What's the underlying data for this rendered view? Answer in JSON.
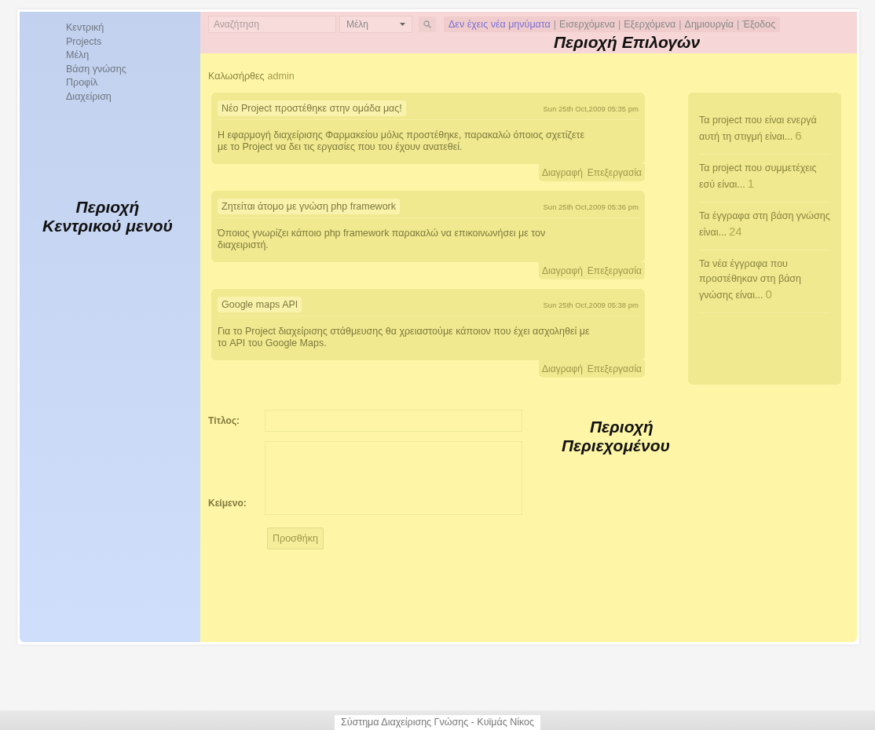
{
  "header": {
    "search": {
      "placeholder": "Αναζήτηση"
    },
    "select": {
      "value": "Μέλη"
    },
    "separator": "|",
    "links": [
      {
        "label": "Δεν έχεις νέα μηνύματα",
        "kind": "status"
      },
      {
        "label": "Εισερχόμενα",
        "kind": "link"
      },
      {
        "label": "Εξερχόμενα",
        "kind": "link"
      },
      {
        "label": "Δημιουργία",
        "kind": "link"
      },
      {
        "label": "Έξοδος",
        "kind": "link"
      }
    ],
    "annotation": {
      "lines": [
        "Περιοχή Επιλογών"
      ]
    }
  },
  "sidebar": {
    "items": [
      "Κεντρική",
      "Projects",
      "Μέλη",
      "Βάση γνώσης",
      "Προφίλ",
      "Διαχείριση"
    ],
    "annotation": {
      "lines": [
        "Περιοχή",
        "Κεντρικού μενού"
      ]
    }
  },
  "welcome": {
    "greeting": "Καλωσήρθες",
    "user": "admin"
  },
  "posts": [
    {
      "title": "Νέο Project προστέθηκε στην ομάδα μας!",
      "date": "Sun 25th Oct,2009 05:35 pm",
      "body": "Η εφαρμογή διαχείρισης Φαρμακείου μόλις προστέθηκε, παρακαλώ όποιος σχετίζετε με το Project να δει τις εργασίες που του έχουν ανατεθεί.",
      "actions": [
        "Διαγραφή",
        "Επεξεργασία"
      ]
    },
    {
      "title": "Ζητείται άτομο με γνώση php framework",
      "date": "Sun 25th Oct,2009 05:36 pm",
      "body": "Όποιος γνωρίζει κάποιο php framework παρακαλώ να επικοινωνήσει με τον διαχειριστή.",
      "actions": [
        "Διαγραφή",
        "Επεξεργασία"
      ]
    },
    {
      "title": "Google maps API",
      "date": "Sun 25th Oct,2009 05:38 pm",
      "body": "Για το Project διαχείρισης στάθμευσης θα χρειαστούμε κάποιον που έχει ασχοληθεί με το API του Google Maps.",
      "actions": [
        "Διαγραφή",
        "Επεξεργασία"
      ]
    }
  ],
  "stats": [
    {
      "text": "Τα project που είναι ενεργά αυτή τη στιγμή είναι...",
      "value": "6"
    },
    {
      "text": "Τα project που συμμετέχεις εσύ είναι...",
      "value": "1"
    },
    {
      "text": "Τα έγγραφα στη βάση γνώσης είναι...",
      "value": "24"
    },
    {
      "text": "Τα νέα έγγραφα που προστέθηκαν στη βάση γνώσης είναι...",
      "value": "0"
    }
  ],
  "form": {
    "title_label": "Τίτλος:",
    "text_label": "Κείμενο:",
    "button": "Προσθήκη",
    "annotation": {
      "lines": [
        "Περιοχή",
        "Περιεχομένου"
      ]
    }
  },
  "footer": "Σύστημα Διαχείρισης Γνώσης - Κυϊμάς Νίκος"
}
